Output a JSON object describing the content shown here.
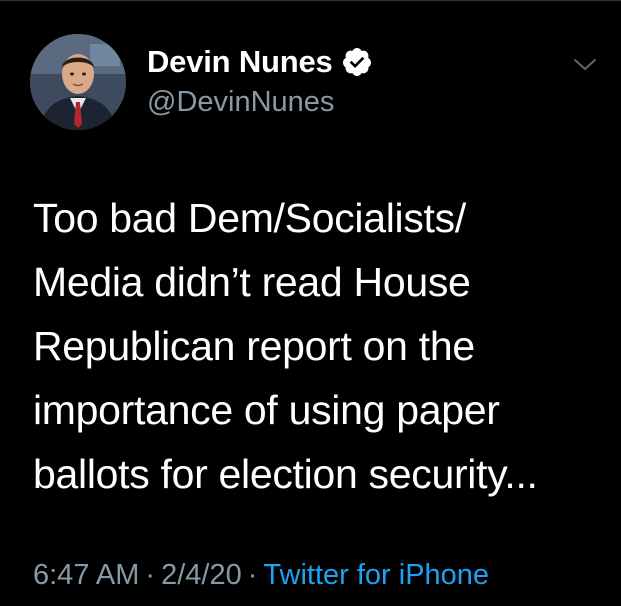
{
  "author": {
    "display_name": "Devin Nunes",
    "handle": "@DevinNunes",
    "verified": true,
    "avatar_icon": "person-portrait-icon"
  },
  "tweet": {
    "text": "Too bad Dem/Socialists/\nMedia didn’t read House\nRepublican report on the\nimportance of using paper\nballots for election security...",
    "time": "6:47 AM",
    "date": "2/4/20",
    "source": "Twitter for iPhone",
    "separator": "·"
  },
  "icons": {
    "verified": "verified-badge-icon",
    "menu": "chevron-down-icon"
  },
  "colors": {
    "background": "#000000",
    "text_primary": "#ffffff",
    "text_secondary": "#8899a6",
    "link": "#1da1f2",
    "divider": "#2f3336"
  }
}
